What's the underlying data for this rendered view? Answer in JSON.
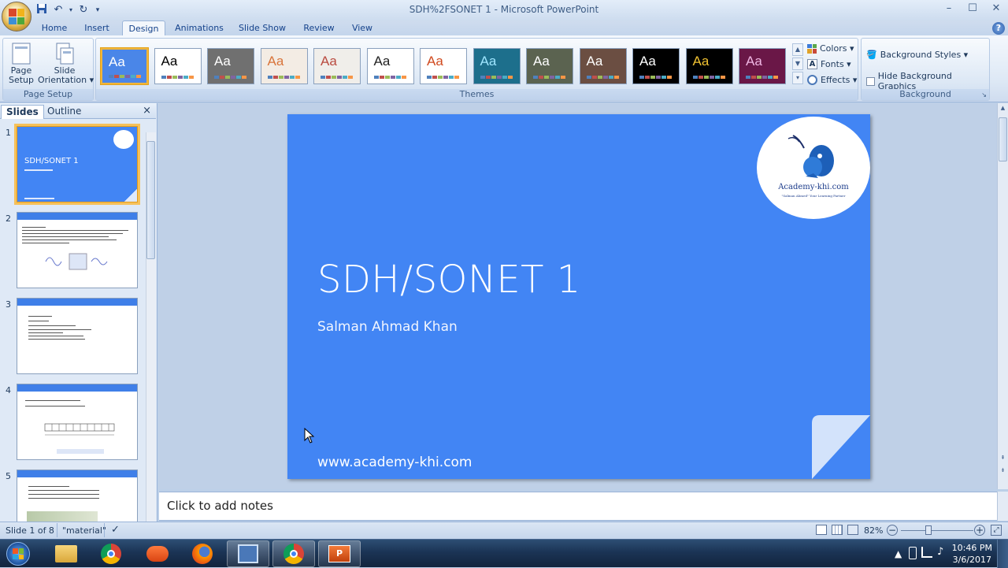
{
  "window": {
    "title": "SDH%2FSONET 1 - Microsoft PowerPoint",
    "controls": [
      "minimize-icon",
      "maximize-icon",
      "close-icon"
    ]
  },
  "quick_access": [
    "save-icon",
    "undo-icon",
    "redo-icon",
    "customize-icon"
  ],
  "tabs": [
    "Home",
    "Insert",
    "Design",
    "Animations",
    "Slide Show",
    "Review",
    "View"
  ],
  "active_tab": "Design",
  "ribbon": {
    "page_setup": {
      "label": "Page Setup",
      "page_setup_btn": "Page\nSetup",
      "orientation_btn": "Slide\nOrientation ▾"
    },
    "themes": {
      "label": "Themes",
      "items": [
        {
          "aa": "Aa",
          "bg": "#4a86e8",
          "fg": "#ffffff"
        },
        {
          "aa": "Aa",
          "bg": "#ffffff",
          "fg": "#000000"
        },
        {
          "aa": "Aa",
          "bg": "#707070",
          "fg": "#ffffff"
        },
        {
          "aa": "Aa",
          "bg": "#f3ece4",
          "fg": "#d8743a"
        },
        {
          "aa": "Aa",
          "bg": "#f0eeea",
          "fg": "#b94a3f"
        },
        {
          "aa": "Aa",
          "bg": "#ffffff",
          "fg": "#222222"
        },
        {
          "aa": "Aa",
          "bg": "#ffffff",
          "fg": "#d04a1f"
        },
        {
          "aa": "Aa",
          "bg": "#1d6f8c",
          "fg": "#9fe6ff"
        },
        {
          "aa": "Aa",
          "bg": "#5b6350",
          "fg": "#ffffff"
        },
        {
          "aa": "Aa",
          "bg": "#6b4e42",
          "fg": "#ffffff"
        },
        {
          "aa": "Aa",
          "bg": "#000000",
          "fg": "#ffffff"
        },
        {
          "aa": "Aa",
          "bg": "#000000",
          "fg": "#f1c232"
        },
        {
          "aa": "Aa",
          "bg": "#6a1747",
          "fg": "#f0b7e4"
        }
      ],
      "colors_btn": "Colors ▾",
      "fonts_btn": "Fonts ▾",
      "effects_btn": "Effects ▾"
    },
    "background": {
      "label": "Background",
      "styles_btn": "Background Styles ▾",
      "hide_graphics": "Hide Background Graphics"
    }
  },
  "panel": {
    "tab_slides": "Slides",
    "tab_outline": "Outline",
    "close": "×",
    "thumbs": [
      {
        "num": "1",
        "title": "SDH/SONET 1"
      },
      {
        "num": "2",
        "title": ""
      },
      {
        "num": "3",
        "title": ""
      },
      {
        "num": "4",
        "title": ""
      },
      {
        "num": "5",
        "title": ""
      }
    ]
  },
  "slide": {
    "title": "SDH/SONET 1",
    "subtitle": "Salman Ahmad Khan",
    "url": "www.academy-khi.com",
    "logo_text": "Academy-khi.com",
    "logo_tag": "\"Salman Ahmed\" Your Learning Partner"
  },
  "notes_placeholder": "Click to add notes",
  "status": {
    "slide_counter": "Slide 1 of 8",
    "theme_name": "\"material\"",
    "zoom": "82%"
  },
  "taskbar": {
    "time": "10:46 PM",
    "date": "3/6/2017"
  },
  "colors": {
    "slide_bg": "#4285f4",
    "accent": "#f0b53a"
  }
}
